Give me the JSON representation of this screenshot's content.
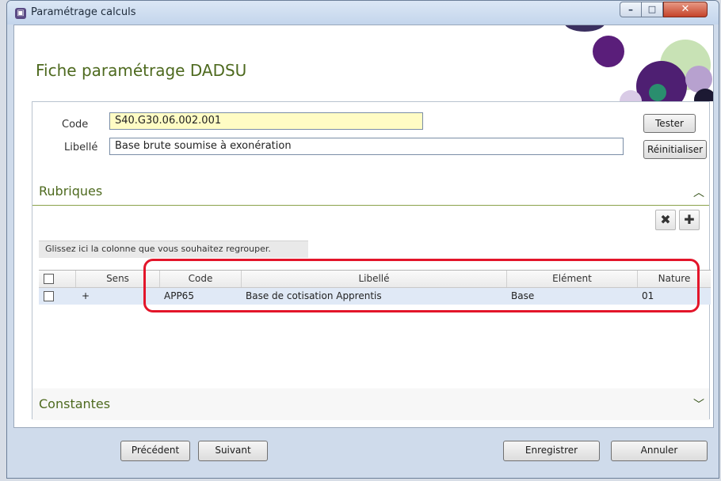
{
  "window": {
    "title": "Paramétrage calculs"
  },
  "header": {
    "title": "Fiche paramétrage DADSU"
  },
  "form": {
    "code_label": "Code",
    "code_value": "S40.G30.06.002.001",
    "libelle_label": "Libellé",
    "libelle_value": "Base brute soumise à exonération",
    "tester_label": "Tester",
    "reinit_label": "Réinitialiser"
  },
  "rubriques": {
    "title": "Rubriques",
    "group_hint": "Glissez ici la colonne que vous souhaitez regrouper.",
    "columns": [
      "Sens",
      "Code",
      "Libellé",
      "Elément",
      "Nature"
    ],
    "rows": [
      {
        "sens": "+",
        "code": "APP65",
        "libelle": "Base de cotisation Apprentis",
        "element": "Base",
        "nature": "01"
      }
    ]
  },
  "constantes": {
    "title": "Constantes"
  },
  "footer": {
    "precedent": "Précédent",
    "suivant": "Suivant",
    "enregistrer": "Enregistrer",
    "annuler": "Annuler"
  },
  "icons": {
    "delete": "close-x-icon",
    "add": "plus-icon",
    "collapse": "chevron-up-icon",
    "expand": "chevron-down-icon"
  },
  "colors": {
    "accent_green": "#4e6a1f",
    "highlight_red": "#e3152a",
    "code_field_bg": "#fffcc4"
  }
}
